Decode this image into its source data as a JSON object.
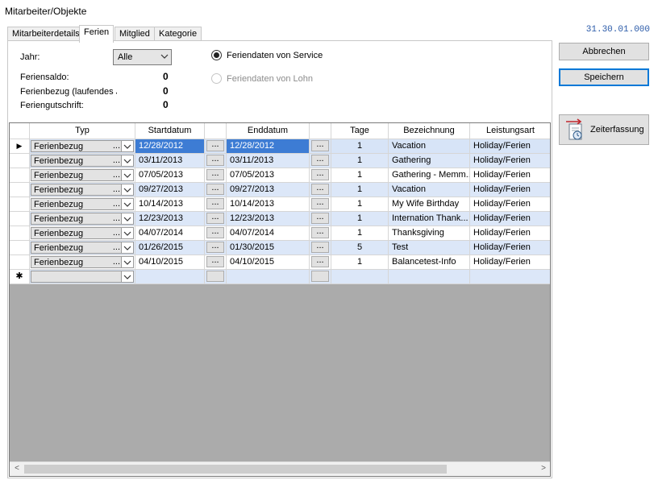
{
  "window": {
    "title": "Mitarbeiter/Objekte",
    "version": "31.30.01.000"
  },
  "tabs": [
    {
      "label": "Mitarbeiterdetails"
    },
    {
      "label": "Ferien"
    },
    {
      "label": "Mitglied"
    },
    {
      "label": "Kategorie"
    }
  ],
  "form": {
    "jahr_label": "Jahr:",
    "jahr_value": "Alle",
    "feriensaldo_label": "Feriensaldo:",
    "feriensaldo_value": "0",
    "ferienbezug_label": "Ferienbezug (laufendes Ja",
    "ferienbezug_value": "0",
    "feriengutschrift_label": "Feriengutschrift:",
    "feriengutschrift_value": "0",
    "radio_service": "Feriendaten von Service",
    "radio_lohn": "Feriendaten von Lohn"
  },
  "buttons": {
    "abbrechen": "Abbrechen",
    "speichern": "Speichern",
    "zeiterfassung": "Zeiterfassung"
  },
  "grid": {
    "columns": [
      "Typ",
      "Startdatum",
      "",
      "Enddatum",
      "",
      "Tage",
      "Bezeichnung",
      "Leistungsart"
    ],
    "ellipsis": "...",
    "truncated_marker": "...",
    "rows": [
      {
        "typ": "Ferienbezug",
        "start": "12/28/2012",
        "end": "12/28/2012",
        "tage": "1",
        "bez": "Vacation",
        "art": "Holiday/Ferien"
      },
      {
        "typ": "Ferienbezug",
        "start": "03/11/2013",
        "end": "03/11/2013",
        "tage": "1",
        "bez": "Gathering",
        "art": "Holiday/Ferien"
      },
      {
        "typ": "Ferienbezug",
        "start": "07/05/2013",
        "end": "07/05/2013",
        "tage": "1",
        "bez": "Gathering - Memm...",
        "art": "Holiday/Ferien"
      },
      {
        "typ": "Ferienbezug",
        "start": "09/27/2013",
        "end": "09/27/2013",
        "tage": "1",
        "bez": "Vacation",
        "art": "Holiday/Ferien"
      },
      {
        "typ": "Ferienbezug",
        "start": "10/14/2013",
        "end": "10/14/2013",
        "tage": "1",
        "bez": "My Wife Birthday",
        "art": "Holiday/Ferien"
      },
      {
        "typ": "Ferienbezug",
        "start": "12/23/2013",
        "end": "12/23/2013",
        "tage": "1",
        "bez": "Internation Thank...",
        "art": "Holiday/Ferien"
      },
      {
        "typ": "Ferienbezug",
        "start": "04/07/2014",
        "end": "04/07/2014",
        "tage": "1",
        "bez": "Thanksgiving",
        "art": "Holiday/Ferien"
      },
      {
        "typ": "Ferienbezug",
        "start": "01/26/2015",
        "end": "01/30/2015",
        "tage": "5",
        "bez": "Test",
        "art": "Holiday/Ferien"
      },
      {
        "typ": "Ferienbezug",
        "start": "04/10/2015",
        "end": "04/10/2015",
        "tage": "1",
        "bez": "Balancetest-Info",
        "art": "Holiday/Ferien"
      }
    ],
    "current_row_marker": "▶",
    "new_row_marker": "✱"
  },
  "colors": {
    "selected_row": "#d7e4f7",
    "alt_row": "#dce7f8",
    "primary_border": "#0078d7",
    "version_text": "#2a5aa8"
  },
  "icons": {
    "dropdown": "chevron-down-icon",
    "zeiterfassung": "clock-document-arrow-icon",
    "scroll_left": "arrow-left-icon",
    "scroll_right": "arrow-right-icon"
  }
}
